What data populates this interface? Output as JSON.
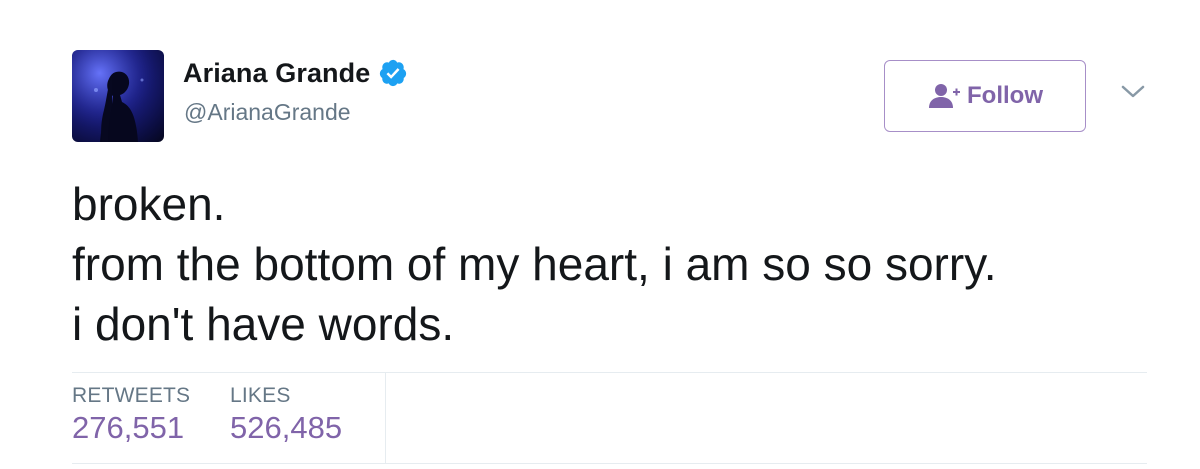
{
  "user": {
    "display_name": "Ariana Grande",
    "handle": "@ArianaGrande",
    "verified": true,
    "avatar_icon": "profile-photo"
  },
  "actions": {
    "follow_label": "Follow",
    "follow_icon": "add-user-icon",
    "menu_icon": "chevron-down-icon"
  },
  "tweet": {
    "lines": [
      "broken.",
      "from the bottom of my heart, i am so so sorry.",
      "i don't have words."
    ]
  },
  "stats": [
    {
      "label": "RETWEETS",
      "value": "276,551"
    },
    {
      "label": "LIKES",
      "value": "526,485"
    }
  ],
  "colors": {
    "accent": "#8064a9",
    "verified": "#1da1f2",
    "muted": "#657786",
    "text": "#14171a",
    "divider": "#e6ecf0"
  }
}
